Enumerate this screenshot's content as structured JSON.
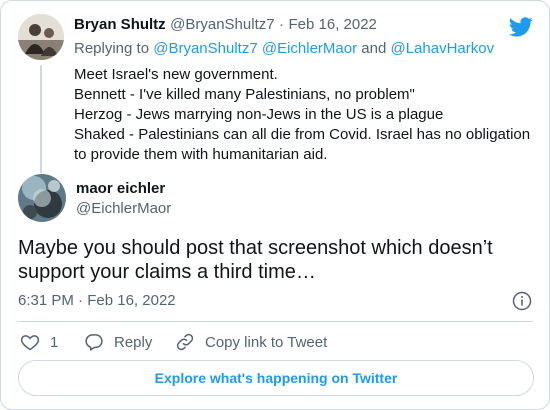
{
  "reply_tweet": {
    "display_name": "Bryan Shultz",
    "handle": "@BryanShultz7",
    "separator": "·",
    "date": "Feb 16, 2022",
    "replying_prefix": "Replying to",
    "replying_handles": [
      "@BryanShultz7",
      "@EichlerMaor"
    ],
    "replying_and": "and",
    "replying_last": "@LahavHarkov",
    "lines": [
      "Meet Israel's new government.",
      "Bennett - I've killed many Palestinians, no problem\"",
      "Herzog - Jews marrying non-Jews in the US is a plague",
      "Shaked - Palestinians can all die from Covid.  Israel has no obligation",
      "to provide them with humanitarian aid."
    ]
  },
  "main_tweet": {
    "display_name": "maor eichler",
    "handle": "@EichlerMaor",
    "text_lines": [
      "Maybe you should post that screenshot which doesn’t",
      "support your claims a third time…"
    ],
    "time": "6:31 PM",
    "separator": "·",
    "date": "Feb 16, 2022"
  },
  "actions": {
    "like_count": "1",
    "reply_label": "Reply",
    "copy_link_label": "Copy link to Tweet"
  },
  "explore_label": "Explore what's happening on Twitter",
  "colors": {
    "accent": "#1d9bf0",
    "muted": "#536471",
    "border": "#cfd9de"
  },
  "icons": [
    "twitter-bird-icon",
    "info-icon",
    "heart-icon",
    "reply-icon",
    "link-icon"
  ]
}
